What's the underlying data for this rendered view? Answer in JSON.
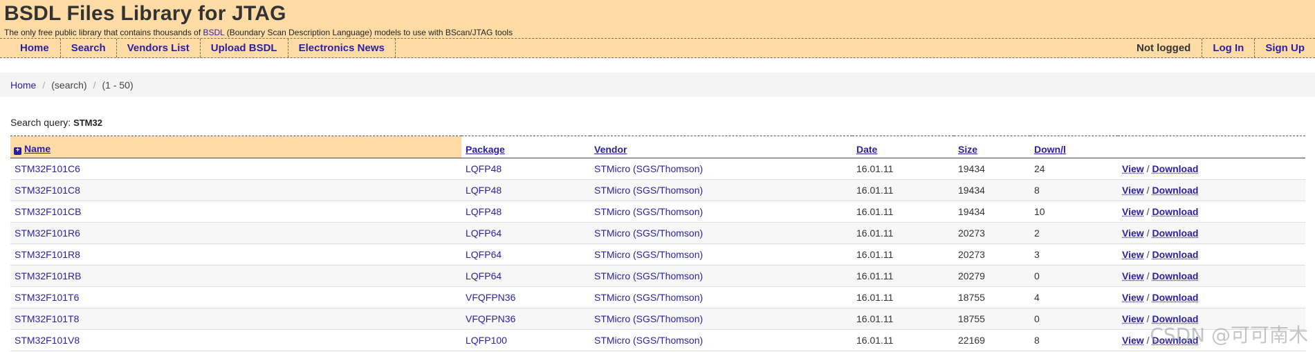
{
  "site": {
    "title": "BSDL Files Library for JTAG",
    "tagline_before": "The only free public library that contains thousands of ",
    "tagline_link": "BSDL",
    "tagline_after": " (Boundary Scan Description Language) models to use with BScan/JTAG tools"
  },
  "nav": {
    "left": [
      "Home",
      "Search",
      "Vendors List",
      "Upload BSDL",
      "Electronics News"
    ],
    "status": "Not logged",
    "login": "Log In",
    "signup": "Sign Up"
  },
  "breadcrumb": {
    "home": "Home",
    "search": "(search)",
    "range": "(1 - 50)"
  },
  "query": {
    "label": "Search query:",
    "value": "STM32"
  },
  "table": {
    "headers": [
      "Name",
      "Package",
      "Vendor",
      "Date",
      "Size",
      "Down/l"
    ],
    "view_label": "View",
    "download_label": "Download",
    "rows": [
      {
        "name": "STM32F101C6",
        "package": "LQFP48",
        "vendor": "STMicro (SGS/Thomson)",
        "date": "16.01.11",
        "size": "19434",
        "downloads": "24"
      },
      {
        "name": "STM32F101C8",
        "package": "LQFP48",
        "vendor": "STMicro (SGS/Thomson)",
        "date": "16.01.11",
        "size": "19434",
        "downloads": "8"
      },
      {
        "name": "STM32F101CB",
        "package": "LQFP48",
        "vendor": "STMicro (SGS/Thomson)",
        "date": "16.01.11",
        "size": "19434",
        "downloads": "10"
      },
      {
        "name": "STM32F101R6",
        "package": "LQFP64",
        "vendor": "STMicro (SGS/Thomson)",
        "date": "16.01.11",
        "size": "20273",
        "downloads": "2"
      },
      {
        "name": "STM32F101R8",
        "package": "LQFP64",
        "vendor": "STMicro (SGS/Thomson)",
        "date": "16.01.11",
        "size": "20273",
        "downloads": "3"
      },
      {
        "name": "STM32F101RB",
        "package": "LQFP64",
        "vendor": "STMicro (SGS/Thomson)",
        "date": "16.01.11",
        "size": "20279",
        "downloads": "0"
      },
      {
        "name": "STM32F101T6",
        "package": "VFQFPN36",
        "vendor": "STMicro (SGS/Thomson)",
        "date": "16.01.11",
        "size": "18755",
        "downloads": "4"
      },
      {
        "name": "STM32F101T8",
        "package": "VFQFPN36",
        "vendor": "STMicro (SGS/Thomson)",
        "date": "16.01.11",
        "size": "18755",
        "downloads": "0"
      },
      {
        "name": "STM32F101V8",
        "package": "LQFP100",
        "vendor": "STMicro (SGS/Thomson)",
        "date": "16.01.11",
        "size": "22169",
        "downloads": "8"
      }
    ]
  },
  "watermark": "CSDN @可可南木",
  "colors": {
    "header_bg": "#ffdca6",
    "link": "#2a1fa0"
  }
}
